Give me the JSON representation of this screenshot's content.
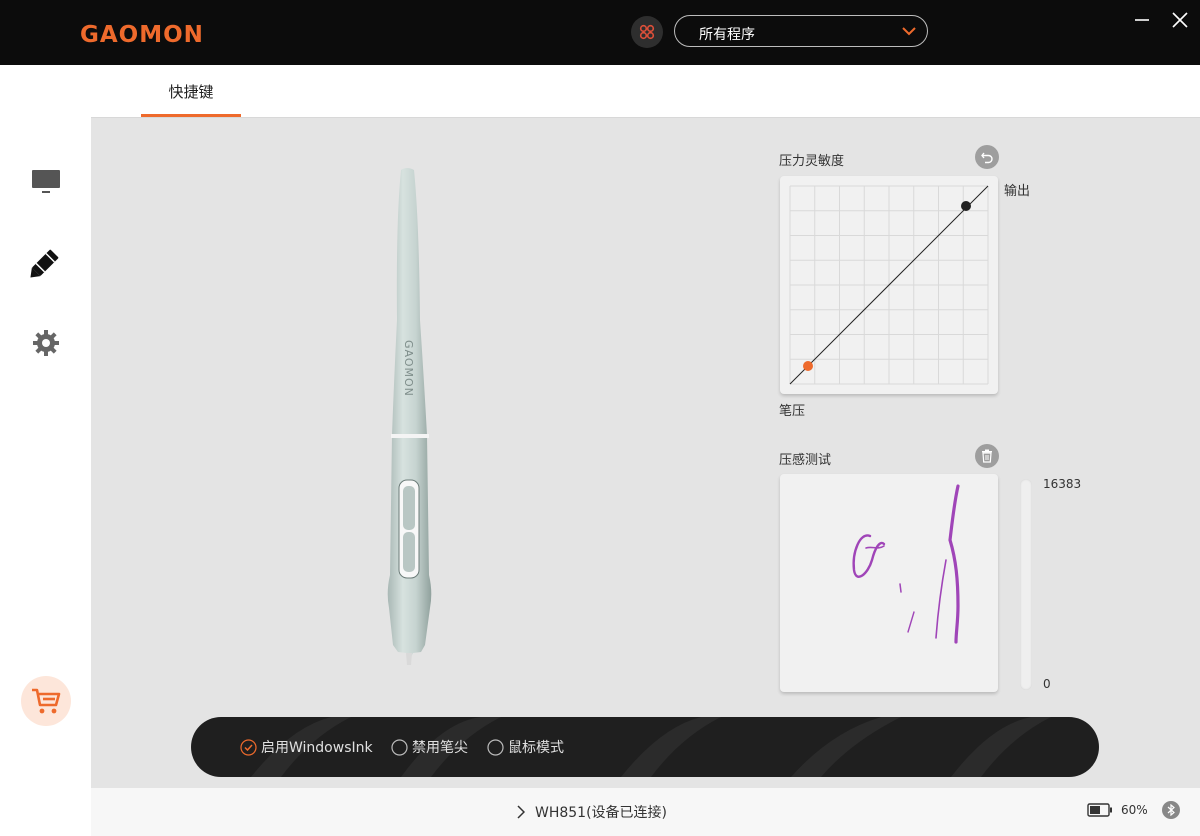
{
  "app": {
    "logo_text": "GAOMON"
  },
  "header": {
    "program_select": {
      "selected": "所有程序"
    }
  },
  "tabs": [
    {
      "label": "快捷键",
      "active": true
    }
  ],
  "sidebar": {
    "items": [
      {
        "icon": "monitor-icon"
      },
      {
        "icon": "pen-icon",
        "active": true
      },
      {
        "icon": "gear-icon"
      },
      {
        "icon": "cart-icon"
      }
    ]
  },
  "pressure_sensitivity": {
    "title": "压力灵敏度",
    "output_label": "输出",
    "input_label": "笔压"
  },
  "pressure_test": {
    "title": "压感测试",
    "max_value": "16383",
    "min_value": "0"
  },
  "options": [
    {
      "label": "启用WindowsInk",
      "checked": true
    },
    {
      "label": "禁用笔尖",
      "checked": false
    },
    {
      "label": "鼠标模式",
      "checked": false
    }
  ],
  "status": {
    "device": "WH851(设备已连接)",
    "battery": "60%"
  },
  "colors": {
    "accent": "#ee6a2c",
    "stroke": "#a045b8"
  }
}
